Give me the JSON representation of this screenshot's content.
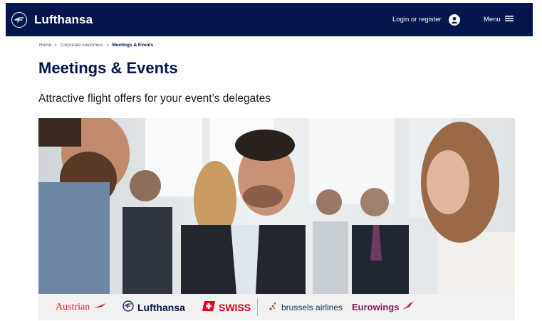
{
  "header": {
    "brand": "Lufthansa",
    "login_label": "Login or register",
    "menu_label": "Menu"
  },
  "breadcrumb": {
    "items": [
      "Home",
      "Corporate customers",
      "Meetings & Events"
    ]
  },
  "page": {
    "title": "Meetings & Events",
    "subtitle": "Attractive flight offers for your event’s delegates"
  },
  "partner_logos": {
    "austrian": "Austrian",
    "lufthansa": "Lufthansa",
    "swiss": "SWISS",
    "brussels": "brussels airlines",
    "eurowings": "Eurowings"
  },
  "colors": {
    "navy": "#05164d",
    "austrian_red": "#d12b2b",
    "swiss_red": "#e2001a",
    "eurowings_burgundy": "#8a1a5a"
  },
  "icons": [
    "crane-logo-icon",
    "account-icon",
    "hamburger-menu-icon",
    "chevron-right-icon"
  ]
}
